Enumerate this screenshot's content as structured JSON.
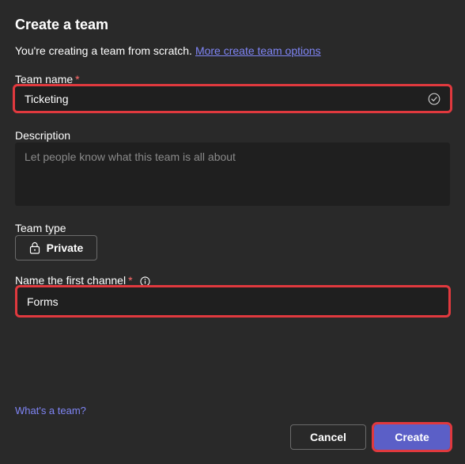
{
  "dialog": {
    "title": "Create a team",
    "subtitle": "You're creating a team from scratch.",
    "more_options_link": "More create team options"
  },
  "team_name": {
    "label": "Team name",
    "required_mark": "*",
    "value": "Ticketing"
  },
  "description": {
    "label": "Description",
    "placeholder": "Let people know what this team is all about"
  },
  "team_type": {
    "label": "Team type",
    "button_label": "Private"
  },
  "first_channel": {
    "label": "Name the first channel",
    "required_mark": "*",
    "value": "Forms"
  },
  "footer": {
    "whats_a_team_link": "What's a team?",
    "cancel_label": "Cancel",
    "create_label": "Create"
  },
  "colors": {
    "background": "#292929",
    "input_background": "#1f1f1f",
    "accent": "#5b5fc7",
    "link": "#7f85f5",
    "highlight": "#e0393e"
  }
}
